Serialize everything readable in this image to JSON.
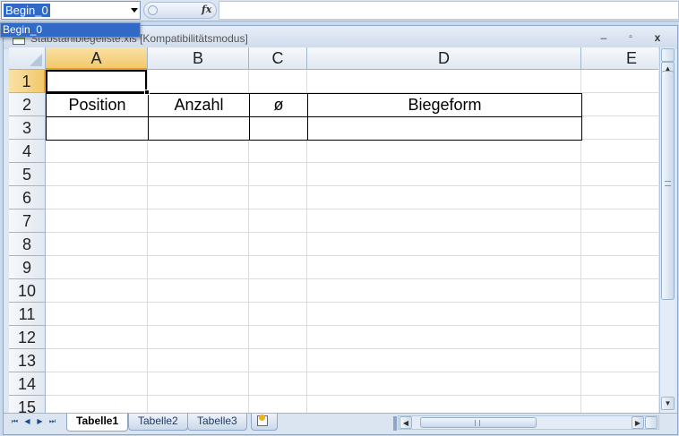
{
  "formula_bar": {
    "name_box_value": "Begin_0",
    "fx_label": "fx",
    "formula_value": ""
  },
  "name_dropdown": {
    "items": [
      "Begin_0"
    ]
  },
  "window": {
    "title": "Stabstahlbiegeliste.xls  [Kompatibilitätsmodus]",
    "minimize": "–",
    "restore": "▫",
    "close": "x"
  },
  "columns": [
    "A",
    "B",
    "C",
    "D",
    "E"
  ],
  "rows": [
    "1",
    "2",
    "3",
    "4",
    "5",
    "6",
    "7",
    "8",
    "9",
    "10",
    "11",
    "12",
    "13",
    "14",
    "15"
  ],
  "active_cell": "A1",
  "table": {
    "headers": [
      "Position",
      "Anzahl",
      "ø",
      "Biegeform"
    ],
    "row3": [
      "",
      "",
      "",
      ""
    ]
  },
  "sheets": {
    "tabs": [
      "Tabelle1",
      "Tabelle2",
      "Tabelle3"
    ],
    "active": "Tabelle1",
    "nav": [
      "⏮",
      "◀",
      "▶",
      "⏭"
    ]
  },
  "colors": {
    "selection_blue": "#3169c6",
    "active_header": "#f3c86a",
    "header_border": "#9eb6ce"
  }
}
